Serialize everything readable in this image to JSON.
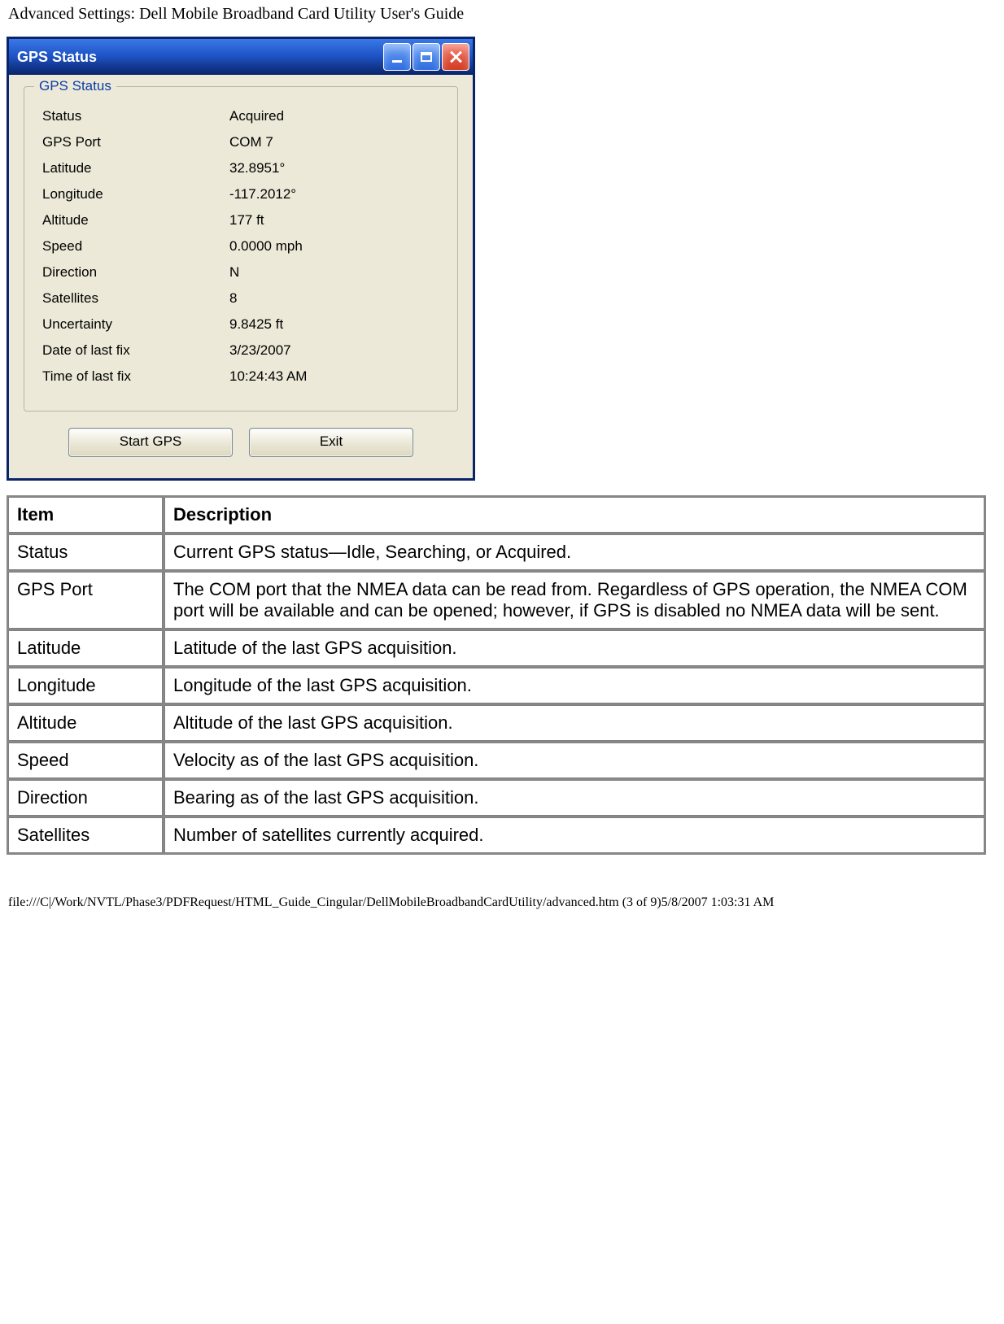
{
  "page_header": "Advanced Settings: Dell Mobile Broadband Card Utility User's Guide",
  "window": {
    "title": "GPS Status",
    "groupbox_legend": "GPS Status",
    "rows": [
      {
        "label": "Status",
        "value": "Acquired"
      },
      {
        "label": "GPS Port",
        "value": "COM 7"
      },
      {
        "label": "Latitude",
        "value": "32.8951°"
      },
      {
        "label": "Longitude",
        "value": "-117.2012°"
      },
      {
        "label": "Altitude",
        "value": "177 ft"
      },
      {
        "label": "Speed",
        "value": "0.0000 mph"
      },
      {
        "label": "Direction",
        "value": "N"
      },
      {
        "label": "Satellites",
        "value": "8"
      },
      {
        "label": "Uncertainty",
        "value": "9.8425 ft"
      },
      {
        "label": "Date of last fix",
        "value": "3/23/2007"
      },
      {
        "label": "Time of last fix",
        "value": "10:24:43 AM"
      }
    ],
    "buttons": {
      "start_gps": "Start GPS",
      "exit": "Exit"
    }
  },
  "table": {
    "header_item": "Item",
    "header_desc": "Description",
    "rows": [
      {
        "item": "Status",
        "desc": "Current GPS status—Idle, Searching, or Acquired."
      },
      {
        "item": "GPS Port",
        "desc": "The COM port that the NMEA data can be read from. Regardless of GPS operation, the NMEA COM port will be available and can be opened; however, if GPS is disabled no NMEA data will be sent."
      },
      {
        "item": "Latitude",
        "desc": "Latitude of the last GPS acquisition."
      },
      {
        "item": "Longitude",
        "desc": "Longitude of the last GPS acquisition."
      },
      {
        "item": "Altitude",
        "desc": "Altitude of the last GPS acquisition."
      },
      {
        "item": "Speed",
        "desc": "Velocity as of the last GPS acquisition."
      },
      {
        "item": "Direction",
        "desc": "Bearing as of the last GPS acquisition."
      },
      {
        "item": "Satellites",
        "desc": "Number of satellites currently acquired."
      }
    ]
  },
  "page_footer": "file:///C|/Work/NVTL/Phase3/PDFRequest/HTML_Guide_Cingular/DellMobileBroadbandCardUtility/advanced.htm (3 of 9)5/8/2007 1:03:31 AM"
}
